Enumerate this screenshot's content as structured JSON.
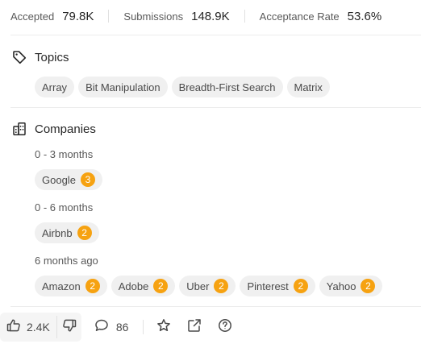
{
  "stats": {
    "accepted_label": "Accepted",
    "accepted_value": "79.8K",
    "submissions_label": "Submissions",
    "submissions_value": "148.9K",
    "acceptance_label": "Acceptance Rate",
    "acceptance_value": "53.6%"
  },
  "topics": {
    "title": "Topics",
    "icon": "tag-icon",
    "items": [
      "Array",
      "Bit Manipulation",
      "Breadth-First Search",
      "Matrix"
    ]
  },
  "companies": {
    "title": "Companies",
    "icon": "building-icon",
    "groups": [
      {
        "period": "0 - 3 months",
        "items": [
          {
            "name": "Google",
            "count": "3"
          }
        ]
      },
      {
        "period": "0 - 6 months",
        "items": [
          {
            "name": "Airbnb",
            "count": "2"
          }
        ]
      },
      {
        "period": "6 months ago",
        "items": [
          {
            "name": "Amazon",
            "count": "2"
          },
          {
            "name": "Adobe",
            "count": "2"
          },
          {
            "name": "Uber",
            "count": "2"
          },
          {
            "name": "Pinterest",
            "count": "2"
          },
          {
            "name": "Yahoo",
            "count": "2"
          }
        ]
      }
    ]
  },
  "footer": {
    "likes": "2.4K",
    "comments": "86",
    "icons": [
      "thumbs-up-icon",
      "thumbs-down-icon",
      "comment-icon",
      "star-icon",
      "share-icon",
      "help-icon"
    ]
  },
  "colors": {
    "badge": "#f6a211",
    "chip_bg": "#f0f0f0",
    "divider": "#ececec"
  }
}
